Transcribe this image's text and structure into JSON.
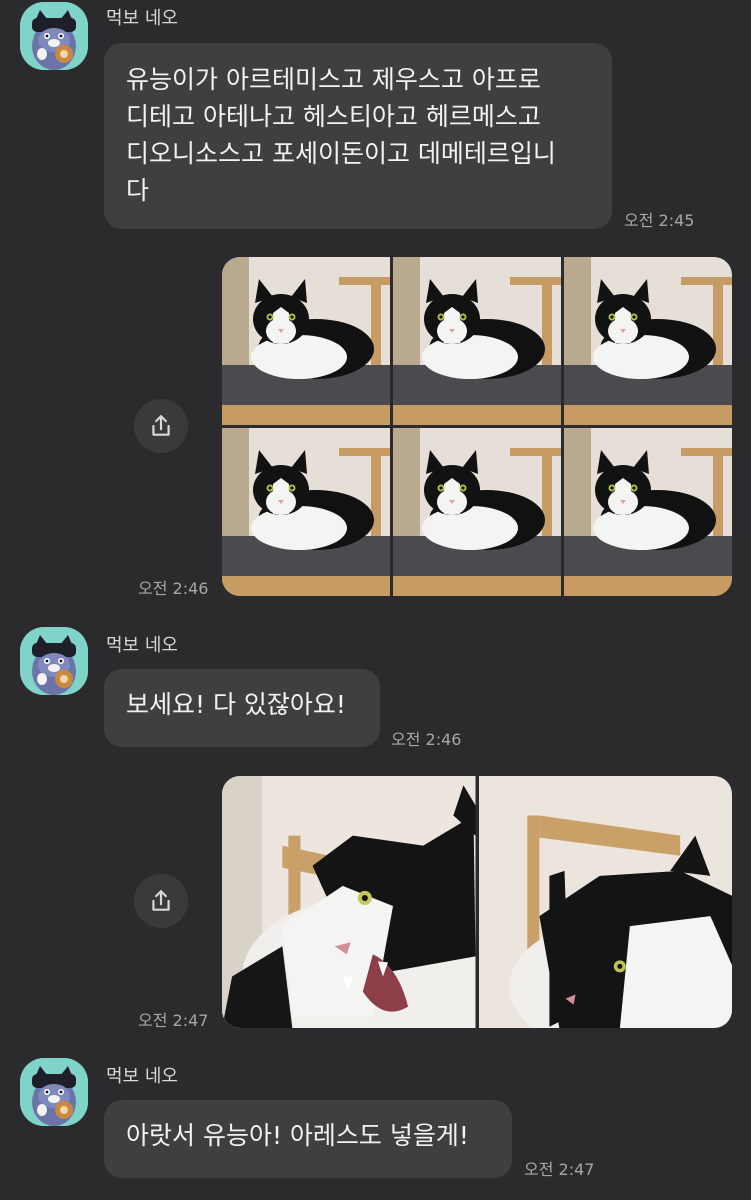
{
  "messages": [
    {
      "sender": "먹보 네오",
      "lines": [
        "유능이가 아르테미스고 제우스고 아프로",
        "디테고 아테나고 헤스티아고 헤르메스고",
        "디오니소스고 포세이돈이고 데메테르입니",
        "다"
      ],
      "time": "오전 2:45"
    },
    {
      "time": "오전 2:46",
      "photo_count": 6,
      "photos": [
        "cat-photo-1",
        "cat-photo-2",
        "cat-photo-3",
        "cat-photo-4",
        "cat-photo-5",
        "cat-photo-6"
      ]
    },
    {
      "sender": "먹보 네오",
      "text": "보세요! 다 있잖아요!",
      "time": "오전 2:46"
    },
    {
      "time": "오전 2:47",
      "photo_count": 2,
      "photos": [
        "cat-hissing-photo",
        "cat-closeup-photo"
      ]
    },
    {
      "sender": "먹보 네오",
      "text": "아랏서 유능아! 아레스도 넣을게!",
      "time": "오전 2:47"
    }
  ],
  "icons": {
    "share": "share-icon",
    "avatar": "avatar-cat-character"
  },
  "colors": {
    "background": "#2b2b2e",
    "bubble": "#3f3f42",
    "avatar": "#7fd3c9",
    "text": "#f2f2f2",
    "time": "#a7a7a7"
  }
}
